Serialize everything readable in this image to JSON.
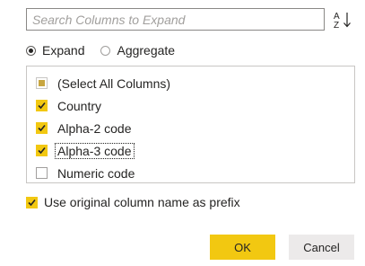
{
  "search": {
    "placeholder": "Search Columns to Expand",
    "value": ""
  },
  "sort": {
    "icon": "sort-az-icon",
    "letters_top": "A",
    "letters_bottom": "Z"
  },
  "mode": {
    "options": [
      {
        "label": "Expand",
        "selected": true
      },
      {
        "label": "Aggregate",
        "selected": false
      }
    ]
  },
  "columns": {
    "items": [
      {
        "label": "(Select All Columns)",
        "state": "indeterminate"
      },
      {
        "label": "Country",
        "state": "checked"
      },
      {
        "label": "Alpha-2 code",
        "state": "checked"
      },
      {
        "label": "Alpha-3 code",
        "state": "checked"
      },
      {
        "label": "Numeric code",
        "state": "unchecked"
      }
    ]
  },
  "prefix": {
    "label": "Use original column name as prefix",
    "checked": true
  },
  "buttons": {
    "ok": "OK",
    "cancel": "Cancel"
  },
  "colors": {
    "accent": "#f2c811",
    "border": "#8a8886",
    "cancel_bg": "#eceaea"
  }
}
